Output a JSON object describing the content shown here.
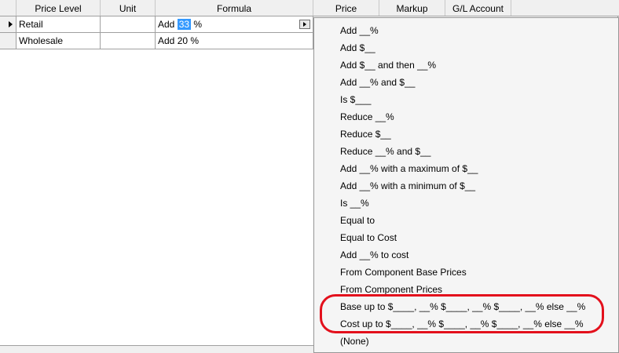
{
  "columns": [
    "Price Level",
    "Unit",
    "Formula",
    "Price",
    "Markup",
    "G/L Account"
  ],
  "rows": [
    {
      "price_level": "Retail",
      "unit": "",
      "formula_prefix": "Add",
      "formula_value": "33",
      "formula_suffix": "%"
    },
    {
      "price_level": "Wholesale",
      "unit": "",
      "formula_prefix": "Add",
      "formula_value": "20",
      "formula_suffix": "%"
    }
  ],
  "menu": {
    "items": [
      "Add __%",
      "Add $__",
      "Add $__ and then __%",
      "Add __% and $__",
      "Is $___",
      "Reduce __%",
      "Reduce $__",
      "Reduce __% and $__",
      "Add __% with a maximum of $__",
      "Add __% with a minimum of $__",
      "Is __%",
      "Equal to",
      "Equal to Cost",
      "Add __% to cost",
      "From Component Base Prices",
      "From Component Prices",
      "Base up to $____, __% $____, __% $____, __% else __%",
      "Cost up to $____, __% $____, __% $____, __% else __%",
      "(None)"
    ]
  },
  "colors": {
    "highlight_ring": "#e3101c",
    "selection": "#3399ff"
  }
}
